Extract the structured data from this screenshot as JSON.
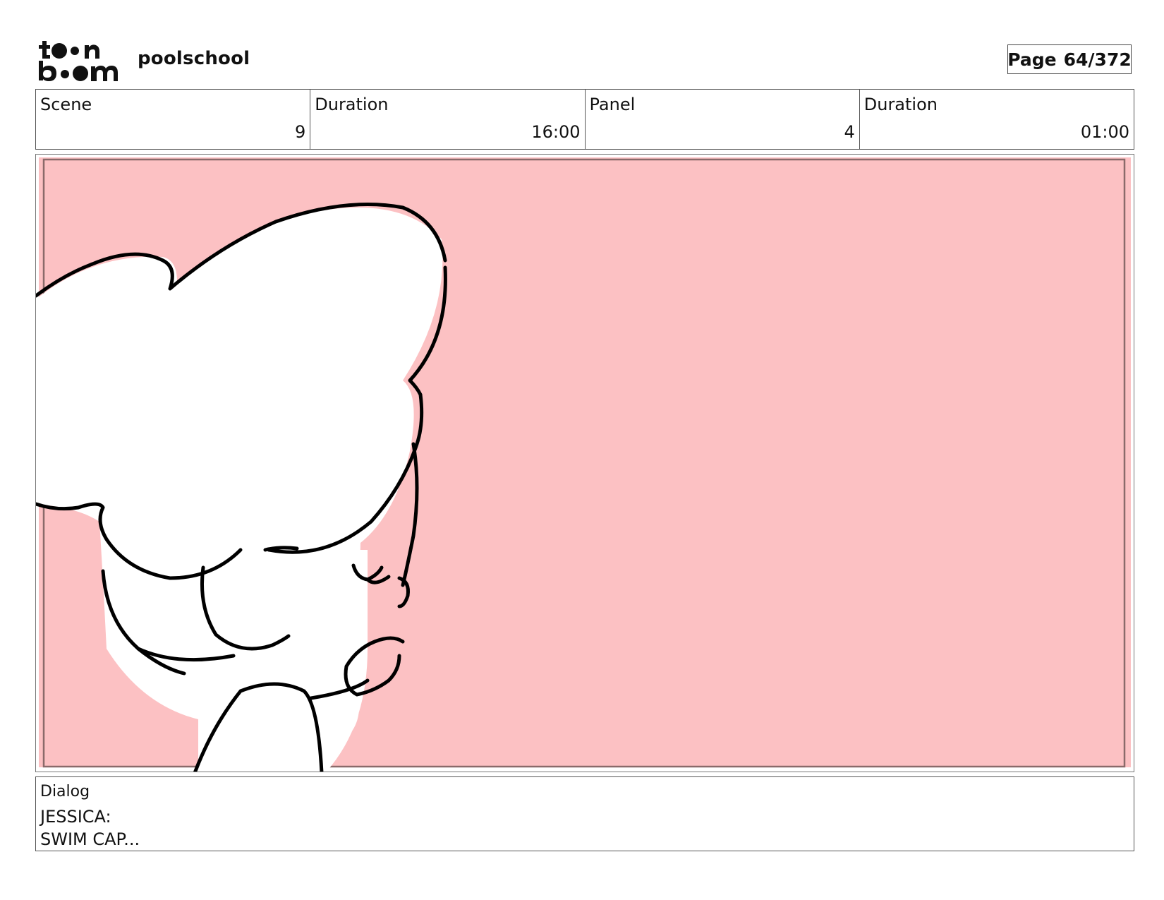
{
  "header": {
    "logo_text_top": "toon",
    "logo_text_bottom": "boom",
    "project_name": "poolschool",
    "page_label": "Page",
    "page_value": "64/372"
  },
  "info": [
    {
      "label": "Scene",
      "value": "9"
    },
    {
      "label": "Duration",
      "value": "16:00"
    },
    {
      "label": "Panel",
      "value": "4"
    },
    {
      "label": "Duration",
      "value": "01:00"
    }
  ],
  "panel": {
    "background_color": "#fcc1c3",
    "border_color": "#8a6a6a"
  },
  "dialog": {
    "label": "Dialog",
    "lines": [
      "JESSICA:",
      "SWIM CAP..."
    ]
  }
}
